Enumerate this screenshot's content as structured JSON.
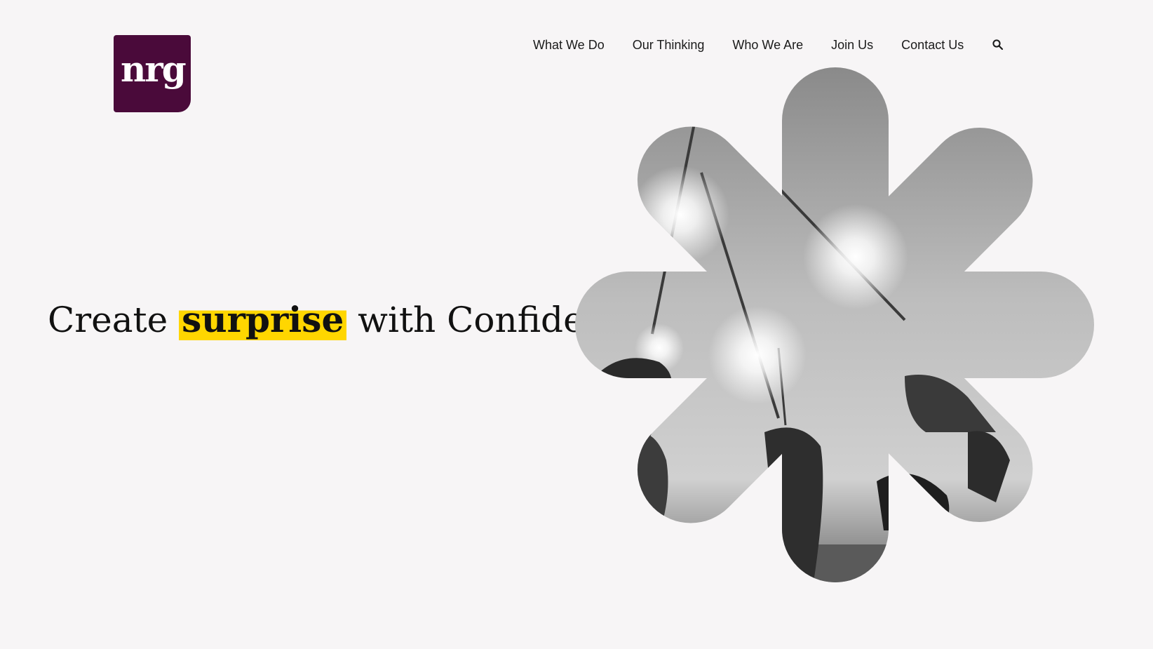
{
  "brand": {
    "logo_text": "nrg",
    "color": "#4a0a3a"
  },
  "nav": {
    "items": [
      {
        "label": "What We Do"
      },
      {
        "label": "Our Thinking"
      },
      {
        "label": "Who We Are"
      },
      {
        "label": "Join Us"
      },
      {
        "label": "Contact Us"
      }
    ],
    "search_icon": "search-icon"
  },
  "hero": {
    "headline_before": "Create",
    "headline_highlight": "surprise",
    "headline_after": "with Confidence",
    "highlight_color": "#ffd600",
    "image_description_icon": "sparklers-photo"
  }
}
